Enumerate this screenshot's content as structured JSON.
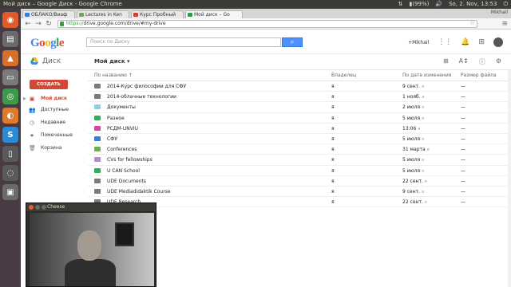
{
  "system": {
    "window_title": "Мой диск – Google Диск - Google Chrome",
    "battery": "(99%)",
    "clock": "So, 2. Nov, 13:53"
  },
  "browser": {
    "tabs": [
      {
        "label": "ОБЛАКО/Виаф",
        "color": "#3b7ddd"
      },
      {
        "label": "Lectures in Ken",
        "color": "#7aa06a"
      },
      {
        "label": "Курс Пробный",
        "color": "#d04030"
      },
      {
        "label": "Мой диск – Go",
        "color": "#2b9b4a",
        "active": true
      }
    ],
    "user": "Mikhail",
    "url_https": "https://",
    "url_rest": "drive.google.com/drive/#my-drive"
  },
  "google": {
    "search_placeholder": "Поиск по Диску",
    "user_link": "+Mikhail"
  },
  "drive": {
    "app_name": "Диск",
    "breadcrumb": "Мой диск ▾",
    "create_label": "СОЗДАТЬ",
    "nav": [
      {
        "label": "Мой диск",
        "icon": "▣",
        "active": true
      },
      {
        "label": "Доступные",
        "icon": "👥"
      },
      {
        "label": "Недавние",
        "icon": "◷"
      },
      {
        "label": "Помеченные",
        "icon": "★"
      },
      {
        "label": "Корзина",
        "icon": "🗑"
      }
    ],
    "columns": {
      "name": "По названию ↑",
      "owner": "Владелец",
      "modified": "По дате изменения",
      "size": "Размер файла"
    },
    "files": [
      {
        "name": "2014-Курс философии для СФУ",
        "owner": "я",
        "date": "9 сент.",
        "date_by": "я",
        "size": "—",
        "color": "#7a7a7a"
      },
      {
        "name": "2014-облачные технологии",
        "owner": "я",
        "date": "1 нояб.",
        "date_by": "я",
        "size": "—",
        "color": "#7a7a7a"
      },
      {
        "name": "Документы",
        "owner": "я",
        "date": "2 июля",
        "date_by": "я",
        "size": "—",
        "color": "#8cd0e8"
      },
      {
        "name": "Разное",
        "owner": "я",
        "date": "5 июля",
        "date_by": "я",
        "size": "—",
        "color": "#2fae5a"
      },
      {
        "name": "РСДМ-UNVIU",
        "owner": "я",
        "date": "13:06",
        "date_by": "я",
        "size": "—",
        "color": "#d645a4"
      },
      {
        "name": "СФУ",
        "owner": "я",
        "date": "5 июля",
        "date_by": "я",
        "size": "—",
        "color": "#3b7ddd"
      },
      {
        "name": "Conferences",
        "owner": "я",
        "date": "31 марта",
        "date_by": "я",
        "size": "—",
        "color": "#6ab04c"
      },
      {
        "name": "CVs for fellowships",
        "owner": "я",
        "date": "5 июля",
        "date_by": "я",
        "size": "—",
        "color": "#b58dd1"
      },
      {
        "name": "U CAN School",
        "owner": "я",
        "date": "5 июля",
        "date_by": "я",
        "size": "—",
        "color": "#2fae5a"
      },
      {
        "name": "UDE Documents",
        "owner": "я",
        "date": "22 сент.",
        "date_by": "я",
        "size": "—",
        "color": "#7a7a7a"
      },
      {
        "name": "UDE Mediadidaktik Course",
        "owner": "я",
        "date": "9 сент.",
        "date_by": "я",
        "size": "—",
        "color": "#7a7a7a"
      },
      {
        "name": "UDE Research",
        "owner": "я",
        "date": "22 сент.",
        "date_by": "я",
        "size": "—",
        "color": "#7a7a7a"
      }
    ]
  },
  "cheese": {
    "title": "Cheese"
  }
}
